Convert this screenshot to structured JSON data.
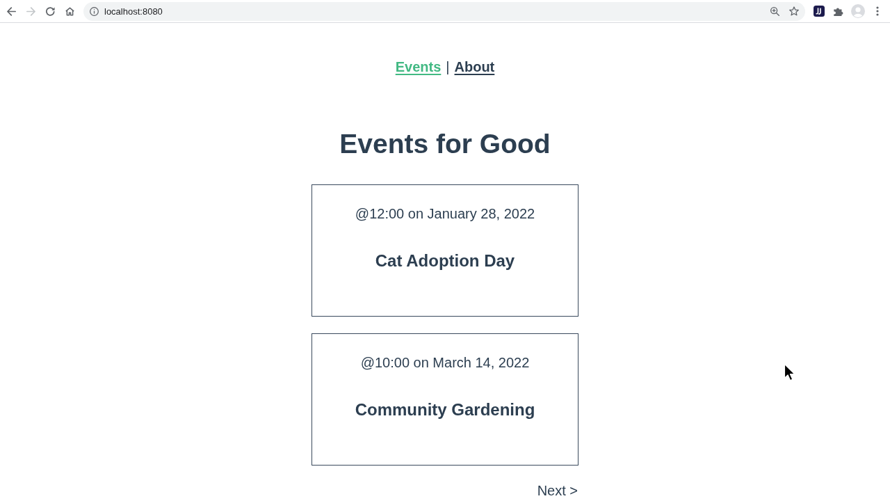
{
  "browser": {
    "nav_buttons": [
      {
        "kind": "back",
        "disabled": false
      },
      {
        "kind": "forward",
        "disabled": true
      },
      {
        "kind": "reload",
        "disabled": false
      },
      {
        "kind": "home",
        "disabled": false
      }
    ],
    "url": "localhost:8080"
  },
  "nav": {
    "links": [
      {
        "label": "Events",
        "selected": true
      },
      {
        "label": "About",
        "selected": false
      }
    ],
    "separator": "|"
  },
  "heading": "Events for Good",
  "events": [
    {
      "datetime": "@12:00 on January 28, 2022",
      "title": "Cat Adoption Day"
    },
    {
      "datetime": "@10:00 on March 14, 2022",
      "title": "Community Gardening"
    }
  ],
  "pagination": {
    "next": "Next >"
  }
}
